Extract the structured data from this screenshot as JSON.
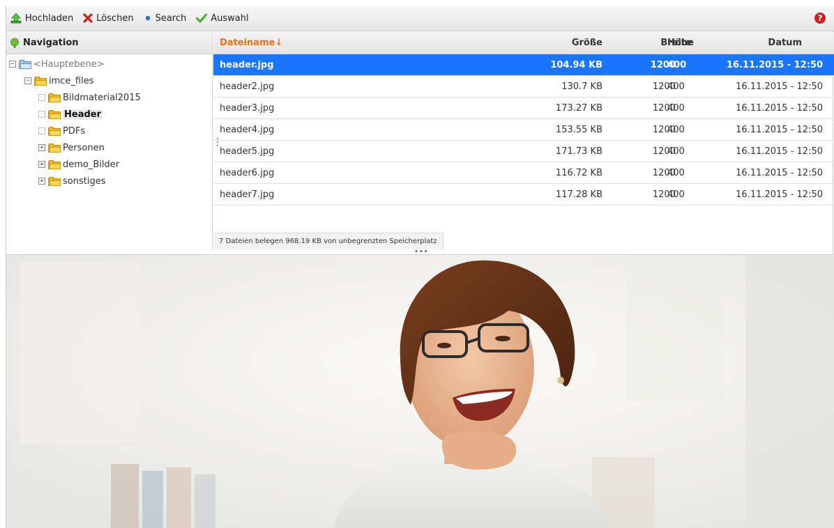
{
  "toolbar": {
    "upload_label": "Hochladen",
    "delete_label": "Löschen",
    "search_label": "Search",
    "select_label": "Auswahl",
    "help_label": "?"
  },
  "navigation": {
    "title": "Navigation",
    "tree": [
      {
        "label": "<Hauptebene>",
        "toggle": "−"
      },
      {
        "label": "imce_files",
        "toggle": "−"
      },
      {
        "label": "Bildmaterial2015",
        "toggle": "·"
      },
      {
        "label": "Header",
        "toggle": "·"
      },
      {
        "label": "PDFs",
        "toggle": "·"
      },
      {
        "label": "Personen",
        "toggle": "+"
      },
      {
        "label": "demo_Bilder",
        "toggle": "+"
      },
      {
        "label": "sonstiges",
        "toggle": "+"
      }
    ]
  },
  "filelist": {
    "columns": {
      "name": "Dateiname↓",
      "size": "Größe",
      "width": "Breite",
      "height": "Höhe",
      "date": "Datum"
    },
    "rows": [
      {
        "name": "header.jpg",
        "size": "104.94 KB",
        "width": "1200",
        "height": "400",
        "date": "16.11.2015 - 12:50",
        "selected": true
      },
      {
        "name": "header2.jpg",
        "size": "130.7 KB",
        "width": "1200",
        "height": "400",
        "date": "16.11.2015 - 12:50"
      },
      {
        "name": "header3.jpg",
        "size": "173.27 KB",
        "width": "1200",
        "height": "400",
        "date": "16.11.2015 - 12:50"
      },
      {
        "name": "header4.jpg",
        "size": "153.55 KB",
        "width": "1200",
        "height": "400",
        "date": "16.11.2015 - 12:50"
      },
      {
        "name": "header5.jpg",
        "size": "171.73 KB",
        "width": "1200",
        "height": "400",
        "date": "16.11.2015 - 12:50"
      },
      {
        "name": "header6.jpg",
        "size": "116.72 KB",
        "width": "1200",
        "height": "400",
        "date": "16.11.2015 - 12:50"
      },
      {
        "name": "header7.jpg",
        "size": "117.28 KB",
        "width": "1200",
        "height": "400",
        "date": "16.11.2015 - 12:50"
      }
    ],
    "status": "7 Dateien belegen 968.19 KB von unbegrenzten Speicherplatz"
  },
  "colors": {
    "selection": "#1a75ff",
    "sort_header": "#e8711c",
    "folder": "#f2b81e"
  }
}
